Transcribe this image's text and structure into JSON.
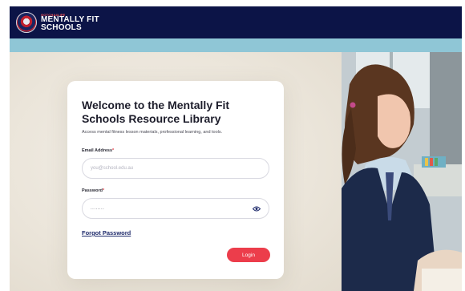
{
  "header": {
    "logo_icon": "school-crest-icon",
    "logo_sup": "GOTCHA4LIFE",
    "logo_line1": "MENTALLY FIT",
    "logo_line2": "SCHOOLS"
  },
  "login": {
    "title": "Welcome to the Mentally Fit Schools Resource Library",
    "subtitle": "Access mental fitness lesson materials, professional learning, and tools.",
    "email_label": "Email Address",
    "email_placeholder": "you@school.edu.au",
    "password_label": "Password",
    "password_value": "........",
    "required_marker": "*",
    "show_password_icon": "eye-icon",
    "forgot_label": "Forgot Password",
    "login_label": "Login"
  },
  "colors": {
    "header_bg": "#0c1447",
    "accent_bar": "#8fc6d6",
    "login_button": "#ec3d4b",
    "link": "#1e2a6b"
  },
  "photo": {
    "subject": "student-in-classroom"
  }
}
